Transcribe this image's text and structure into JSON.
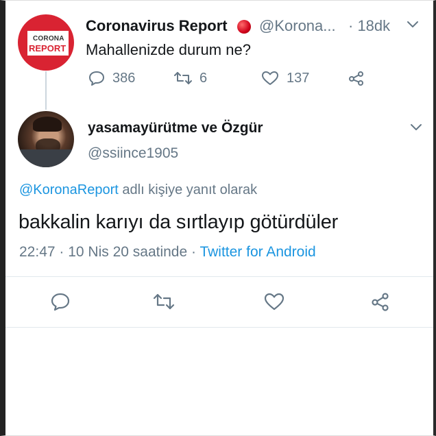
{
  "parent_tweet": {
    "avatar_text_top": "CORONA",
    "avatar_text_bottom": "REPORT",
    "display_name": "Coronavirus Report",
    "handle": "@Korona...",
    "time": "· 18dk",
    "text": "Mahallenizde durum ne?",
    "reply_count": "386",
    "retweet_count": "6",
    "like_count": "137",
    "icons": [
      "reply-icon",
      "retweet-icon",
      "like-icon",
      "share-icon",
      "chevron-down-icon",
      "red-dot-icon"
    ]
  },
  "main_tweet": {
    "display_name": "yasamayürütme ve Özgür",
    "handle": "@ssiince1905",
    "reply_to_handle": "@KoronaReport",
    "reply_to_suffix": " adlı kişiye yanıt olarak",
    "text": "bakkalin karıyı da sırtlayıp götürdüler",
    "time_date": "22:47 · 10 Nis 20 saatinde · ",
    "source": "Twitter for Android",
    "icons": [
      "reply-icon",
      "retweet-icon",
      "like-icon",
      "share-icon",
      "chevron-down-icon"
    ]
  },
  "colors": {
    "accent": "#1b95e0",
    "muted": "#657786",
    "brand_red": "#d92332"
  }
}
